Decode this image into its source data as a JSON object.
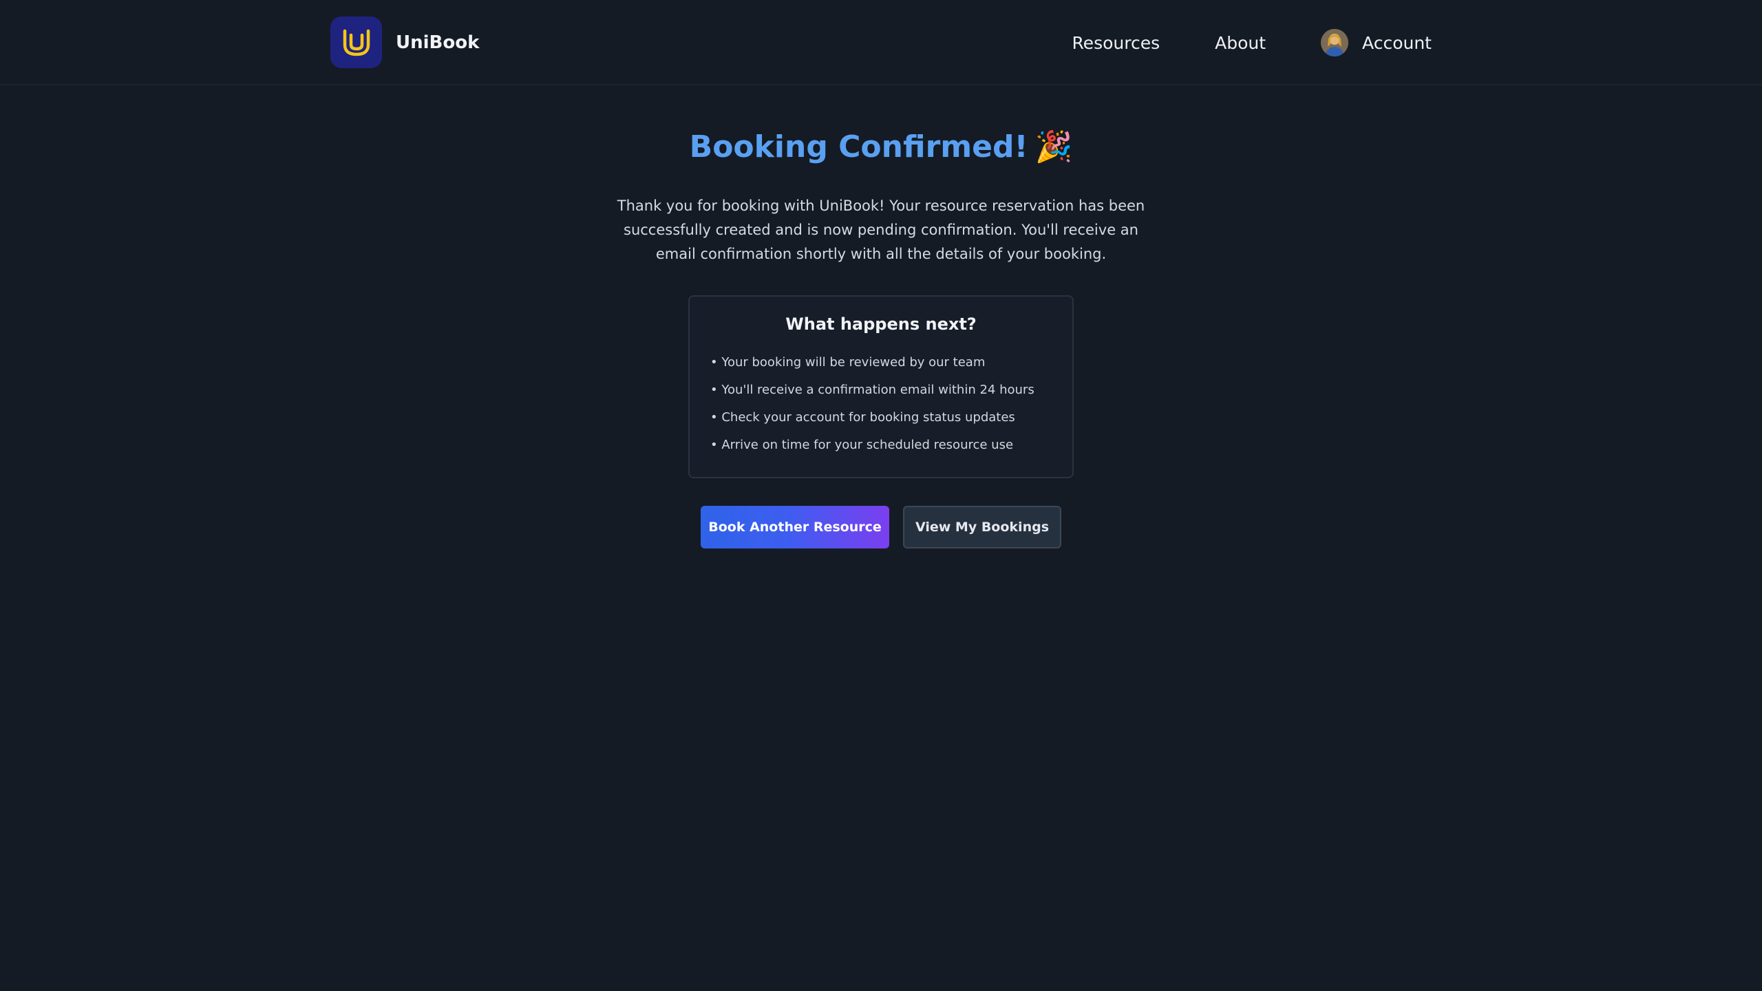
{
  "brand": {
    "name": "UniBook",
    "logo_letter": "U",
    "logo_bg": "#1e2380",
    "logo_color": "#f5c518"
  },
  "nav": {
    "links": [
      "Resources",
      "About"
    ],
    "account_label": "Account"
  },
  "main": {
    "title": "Booking Confirmed!",
    "title_emoji": "🎉",
    "title_color": "#5aa0f2",
    "intro": "Thank you for booking with UniBook! Your resource reservation has been successfully created and is now pending confirmation. You'll receive an email confirmation shortly with all the details of your booking."
  },
  "next_steps": {
    "title": "What happens next?",
    "items": [
      "• Your booking will be reviewed by our team",
      "• You'll receive a confirmation email within 24 hours",
      "• Check your account for booking status updates",
      "• Arrive on time for your scheduled resource use"
    ]
  },
  "actions": {
    "primary_label": "Book Another Resource",
    "secondary_label": "View My Bookings"
  },
  "colors": {
    "background": "#151b24",
    "primary_gradient_start": "#2f63e8",
    "primary_gradient_end": "#7b3ff0"
  }
}
